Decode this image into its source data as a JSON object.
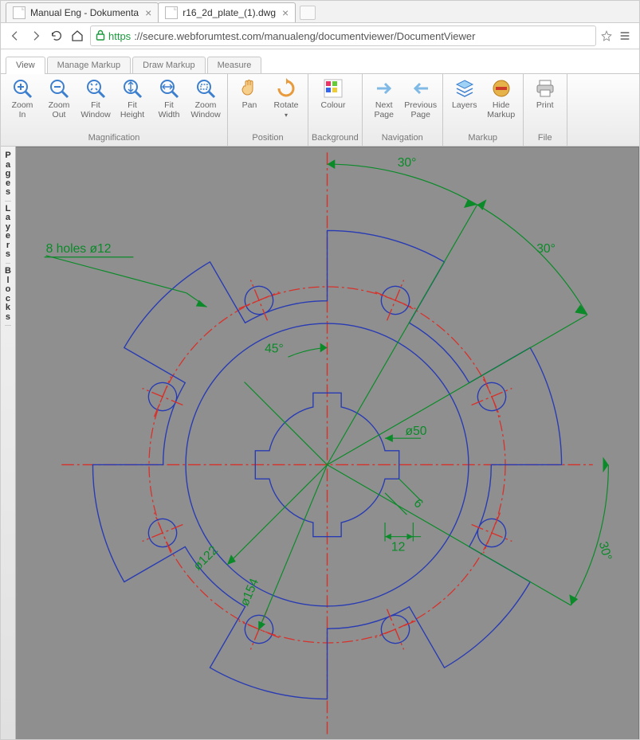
{
  "browser": {
    "tabs": [
      {
        "title": "Manual Eng - Dokumenta",
        "active": false
      },
      {
        "title": "r16_2d_plate_(1).dwg",
        "active": true
      }
    ],
    "url_scheme": "https",
    "url_display": "://secure.webforumtest.com/manualeng/documentviewer/DocumentViewer"
  },
  "app_tabs": [
    "View",
    "Manage Markup",
    "Draw Markup",
    "Measure"
  ],
  "app_tab_selected": 0,
  "ribbon": {
    "groups": [
      {
        "label": "Magnification",
        "items": [
          {
            "id": "zoom-in",
            "label": "Zoom\nIn"
          },
          {
            "id": "zoom-out",
            "label": "Zoom\nOut"
          },
          {
            "id": "fit-window",
            "label": "Fit\nWindow"
          },
          {
            "id": "fit-height",
            "label": "Fit\nHeight"
          },
          {
            "id": "fit-width",
            "label": "Fit\nWidth"
          },
          {
            "id": "zoom-window",
            "label": "Zoom\nWindow"
          }
        ]
      },
      {
        "label": "Position",
        "items": [
          {
            "id": "pan",
            "label": "Pan"
          },
          {
            "id": "rotate",
            "label": "Rotate",
            "dropdown": true
          }
        ]
      },
      {
        "label": "Background",
        "items": [
          {
            "id": "colour",
            "label": "Colour"
          }
        ]
      },
      {
        "label": "Navigation",
        "items": [
          {
            "id": "next-page",
            "label": "Next\nPage"
          },
          {
            "id": "prev-page",
            "label": "Previous\nPage"
          }
        ]
      },
      {
        "label": "Markup",
        "items": [
          {
            "id": "layers",
            "label": "Layers"
          },
          {
            "id": "hide-markup",
            "label": "Hide\nMarkup"
          }
        ]
      },
      {
        "label": "File",
        "items": [
          {
            "id": "print",
            "label": "Print"
          }
        ]
      }
    ]
  },
  "side_tabs": [
    "Pages",
    "Layers",
    "Blocks"
  ],
  "drawing": {
    "annotations": {
      "holes": "8  holes  ø12",
      "ang45": "45°",
      "ang30a": "30°",
      "ang30b": "30°",
      "ang30c": "30°",
      "d50": "ø50",
      "d122": "ø122",
      "d154": "ø154",
      "dim6": "6",
      "dim12": "12"
    }
  }
}
